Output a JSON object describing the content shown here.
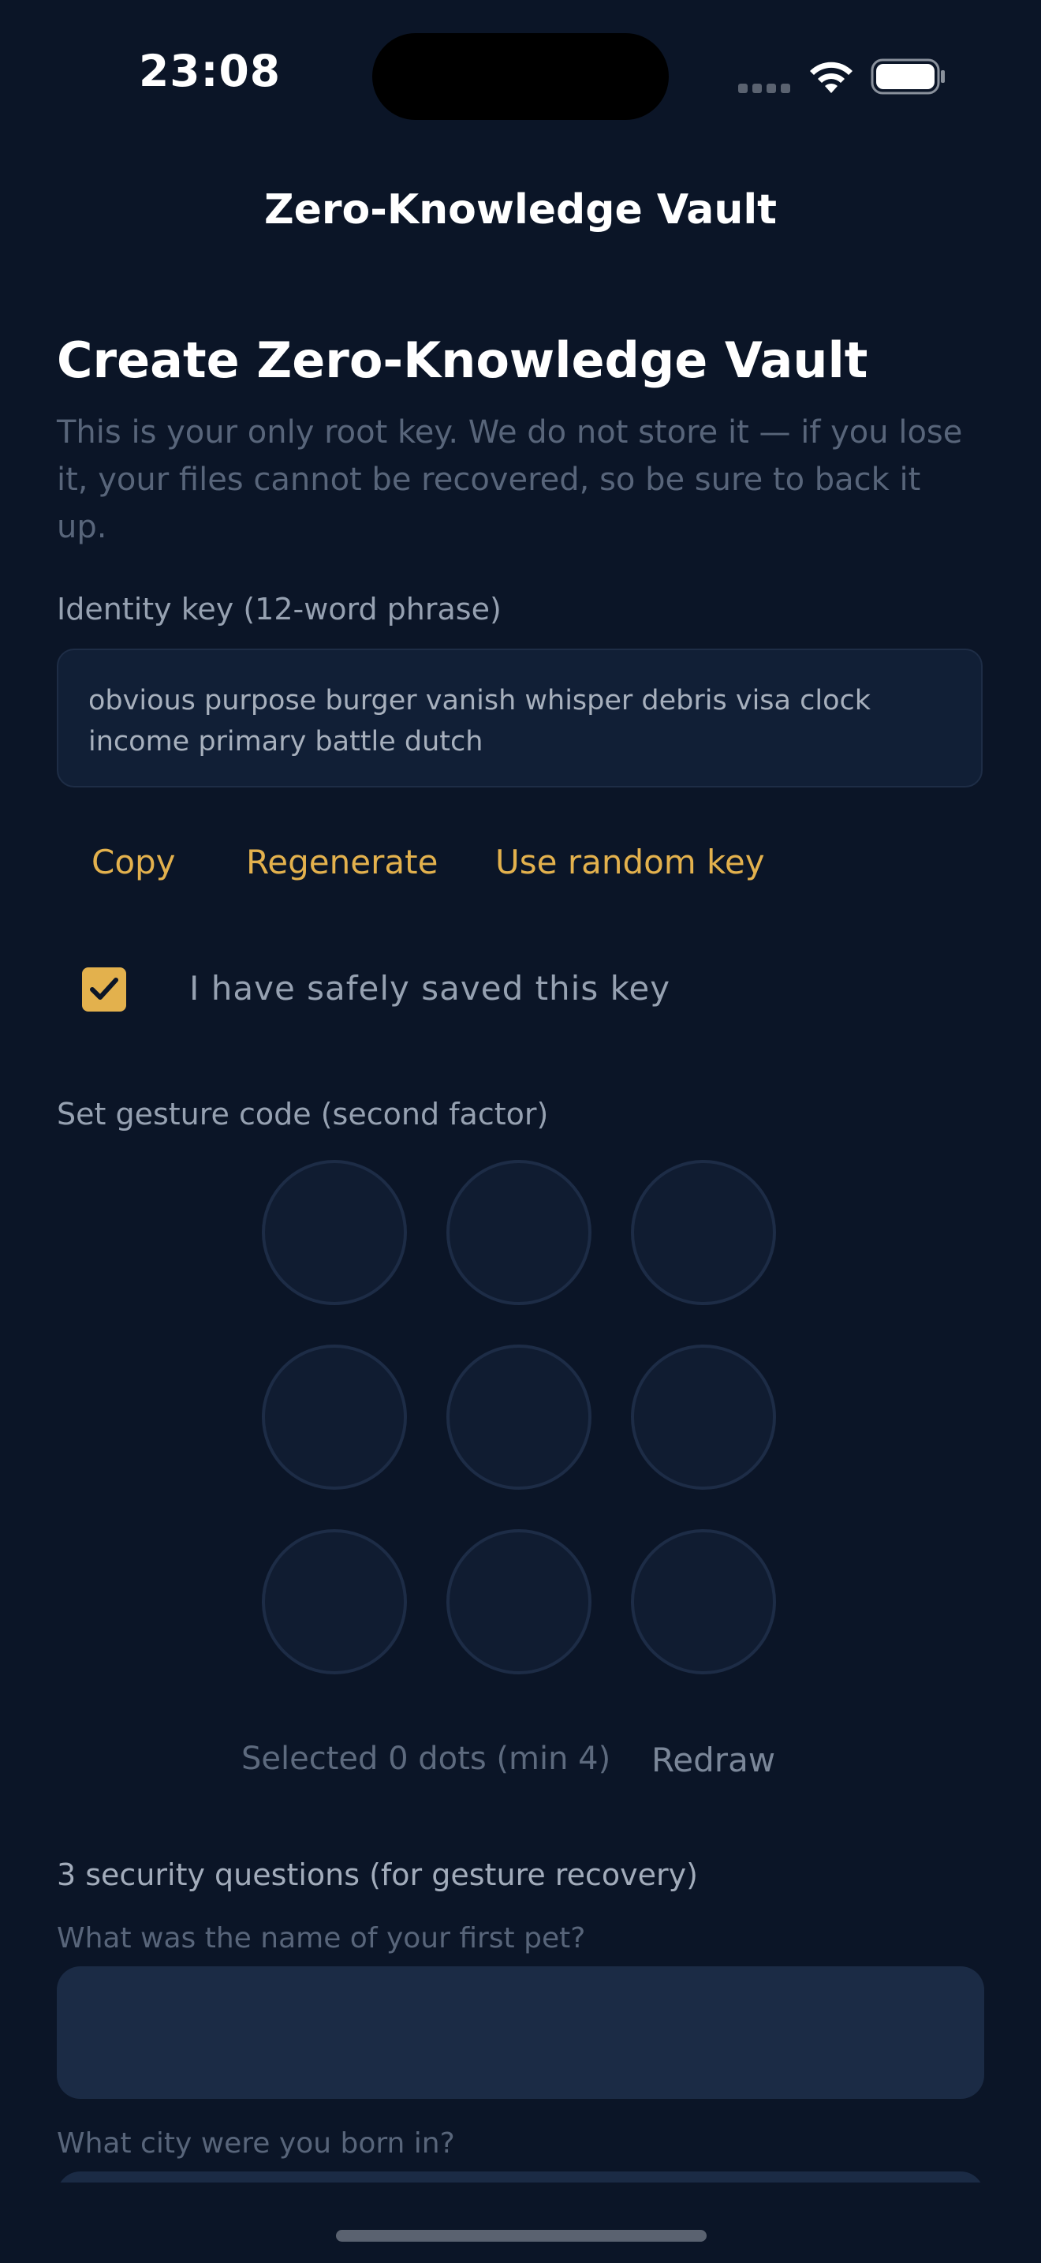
{
  "status_bar": {
    "time": "23:08"
  },
  "nav": {
    "title": "Zero-Knowledge Vault"
  },
  "headline": "Create Zero-Knowledge Vault",
  "subtext": "This is your only root key. We do not store it — if you lose it, your files cannot be recovered, so be sure to back it up.",
  "identity_key": {
    "label": "Identity key (12-word phrase)",
    "phrase": "obvious purpose burger vanish whisper debris visa clock income primary battle dutch"
  },
  "actions": {
    "copy": "Copy",
    "regenerate": "Regenerate",
    "random": "Use random key"
  },
  "confirm": {
    "label": "I have safely saved this key",
    "checked": true
  },
  "gesture": {
    "label": "Set gesture code (second factor)",
    "status": "Selected 0 dots (min 4)",
    "redraw": "Redraw"
  },
  "security": {
    "title": "3 security questions (for gesture recovery)",
    "q1": "What was the name of your first pet?",
    "q2": "What city were you born in?",
    "a1": "",
    "a2": ""
  },
  "colors": {
    "background": "#0b1527",
    "accent": "#e3b14d",
    "input": "#1b2b45"
  },
  "icons": {
    "wifi": "wifi-icon",
    "battery": "battery-icon",
    "check": "checkmark-icon"
  }
}
